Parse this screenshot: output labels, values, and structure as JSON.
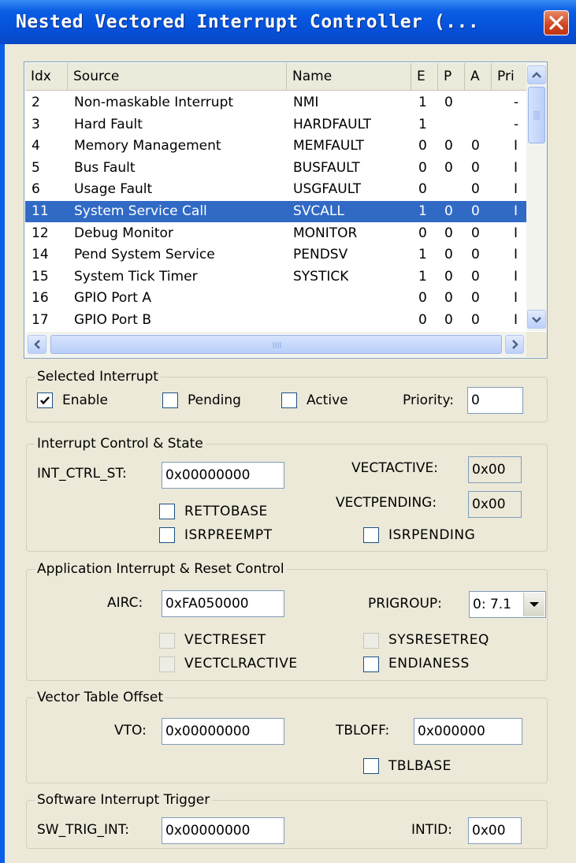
{
  "window": {
    "title": "Nested Vectored Interrupt Controller (..."
  },
  "list": {
    "columns": [
      "Idx",
      "Source",
      "Name",
      "E",
      "P",
      "A",
      "Pri"
    ],
    "rows": [
      {
        "idx": "2",
        "source": "Non-maskable Interrupt",
        "name": "NMI",
        "e": "1",
        "p": "0",
        "a": "",
        "pri": "-"
      },
      {
        "idx": "3",
        "source": "Hard Fault",
        "name": "HARDFAULT",
        "e": "1",
        "p": "",
        "a": "",
        "pri": "-"
      },
      {
        "idx": "4",
        "source": "Memory Management",
        "name": "MEMFAULT",
        "e": "0",
        "p": "0",
        "a": "0",
        "pri": "I"
      },
      {
        "idx": "5",
        "source": "Bus Fault",
        "name": "BUSFAULT",
        "e": "0",
        "p": "0",
        "a": "0",
        "pri": "I"
      },
      {
        "idx": "6",
        "source": "Usage Fault",
        "name": "USGFAULT",
        "e": "0",
        "p": "",
        "a": "0",
        "pri": "I"
      },
      {
        "idx": "11",
        "source": "System Service Call",
        "name": "SVCALL",
        "e": "1",
        "p": "0",
        "a": "0",
        "pri": "I",
        "selected": true
      },
      {
        "idx": "12",
        "source": "Debug Monitor",
        "name": "MONITOR",
        "e": "0",
        "p": "0",
        "a": "0",
        "pri": "I"
      },
      {
        "idx": "14",
        "source": "Pend System Service",
        "name": "PENDSV",
        "e": "1",
        "p": "0",
        "a": "0",
        "pri": "I"
      },
      {
        "idx": "15",
        "source": "System Tick Timer",
        "name": "SYSTICK",
        "e": "1",
        "p": "0",
        "a": "0",
        "pri": "I"
      },
      {
        "idx": "16",
        "source": "GPIO Port A",
        "name": "",
        "e": "0",
        "p": "0",
        "a": "0",
        "pri": "I"
      },
      {
        "idx": "17",
        "source": "GPIO Port B",
        "name": "",
        "e": "0",
        "p": "0",
        "a": "0",
        "pri": "I"
      }
    ]
  },
  "selected_interrupt": {
    "legend": "Selected Interrupt",
    "enable_label": "Enable",
    "enable_checked": true,
    "pending_label": "Pending",
    "pending_checked": false,
    "active_label": "Active",
    "active_checked": false,
    "priority_label": "Priority:",
    "priority_value": "0"
  },
  "icsr": {
    "legend": "Interrupt Control & State",
    "int_ctrl_label": "INT_CTRL_ST:",
    "int_ctrl_value": "0x00000000",
    "vectactive_label": "VECTACTIVE:",
    "vectactive_value": "0x00",
    "vectpending_label": "VECTPENDING:",
    "vectpending_value": "0x00",
    "rettobase_label": "RETTOBASE",
    "isrpreempt_label": "ISRPREEMPT",
    "isrpending_label": "ISRPENDING"
  },
  "airc": {
    "legend": "Application Interrupt & Reset Control",
    "airc_label": "AIRC:",
    "airc_value": "0xFA050000",
    "prigroup_label": "PRIGROUP:",
    "prigroup_value": "0: 7.1",
    "vectreset_label": "VECTRESET",
    "sysresetreq_label": "SYSRESETREQ",
    "vectclractive_label": "VECTCLRACTIVE",
    "endianess_label": "ENDIANESS"
  },
  "vto": {
    "legend": "Vector Table Offset",
    "vto_label": "VTO:",
    "vto_value": "0x00000000",
    "tbloff_label": "TBLOFF:",
    "tbloff_value": "0x000000",
    "tblbase_label": "TBLBASE"
  },
  "swtrig": {
    "legend": "Software Interrupt Trigger",
    "sw_trig_label": "SW_TRIG_INT:",
    "sw_trig_value": "0x00000000",
    "intid_label": "INTID:",
    "intid_value": "0x00"
  },
  "colors": {
    "selection": "#316AC5",
    "titlebar": "#0550D8",
    "dialog": "#ECE9D8"
  }
}
